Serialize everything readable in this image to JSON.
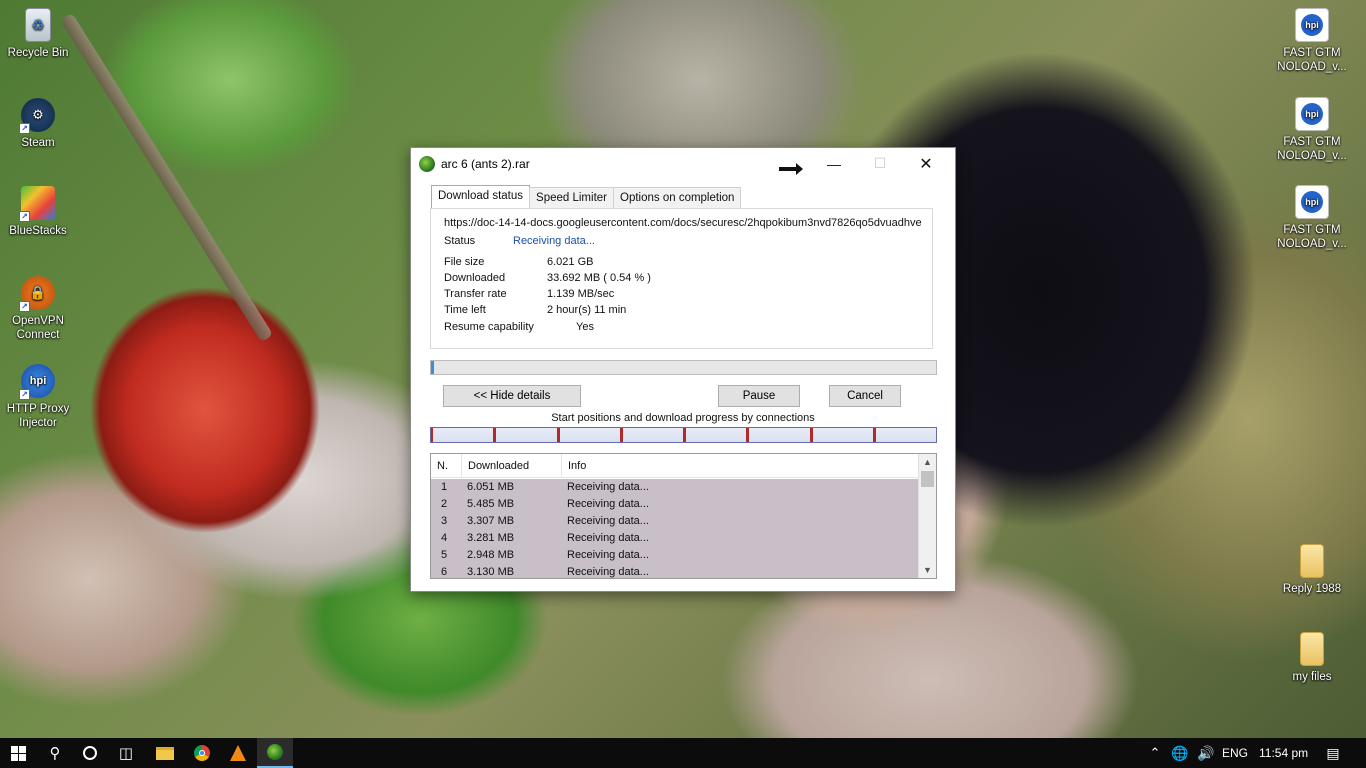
{
  "desktop": {
    "icons_left": [
      {
        "label": "Recycle Bin",
        "icon": "recycle-bin-icon"
      },
      {
        "label": "Steam",
        "icon": "steam-icon"
      },
      {
        "label": "BlueStacks",
        "icon": "bluestacks-icon"
      },
      {
        "label": "OpenVPN Connect",
        "icon": "openvpn-icon"
      },
      {
        "label": "HTTP Proxy Injector",
        "icon": "http-proxy-injector-icon"
      }
    ],
    "icons_right": [
      {
        "label": "FAST GTM NOLOAD_v...",
        "icon": "hpi-file-icon"
      },
      {
        "label": "FAST GTM NOLOAD_v...",
        "icon": "hpi-file-icon"
      },
      {
        "label": "FAST GTM NOLOAD_v...",
        "icon": "hpi-file-icon"
      },
      {
        "label": "Reply 1988",
        "icon": "folder-icon"
      },
      {
        "label": "my files",
        "icon": "folder-icon"
      }
    ]
  },
  "window": {
    "title": "arc 6 (ants 2).rar",
    "tabs": [
      "Download status",
      "Speed Limiter",
      "Options on completion"
    ],
    "url": "https://doc-14-14-docs.googleusercontent.com/docs/securesc/2hqpokibum3nvd7826qo5dvuadhve",
    "status_label": "Status",
    "status_value": "Receiving data...",
    "file_size_label": "File size",
    "file_size_value": "6.021  GB",
    "downloaded_label": "Downloaded",
    "downloaded_value": "33.692  MB  ( 0.54 % )",
    "transfer_rate_label": "Transfer rate",
    "transfer_rate_value": "1.139  MB/sec",
    "time_left_label": "Time left",
    "time_left_value": "2 hour(s) 11 min",
    "resume_label": "Resume capability",
    "resume_value": "Yes",
    "progress_fraction": 0.0054,
    "hide_details_label": "<< Hide details",
    "pause_label": "Pause",
    "cancel_label": "Cancel",
    "connections_caption": "Start positions and download progress by connections",
    "connection_segments": 8,
    "table_headers": {
      "n": "N.",
      "downloaded": "Downloaded",
      "info": "Info"
    },
    "connections": [
      {
        "n": "1",
        "downloaded": "6.051  MB",
        "info": "Receiving data..."
      },
      {
        "n": "2",
        "downloaded": "5.485  MB",
        "info": "Receiving data..."
      },
      {
        "n": "3",
        "downloaded": "3.307  MB",
        "info": "Receiving data..."
      },
      {
        "n": "4",
        "downloaded": "3.281  MB",
        "info": "Receiving data..."
      },
      {
        "n": "5",
        "downloaded": "2.948  MB",
        "info": "Receiving data..."
      },
      {
        "n": "6",
        "downloaded": "3.130  MB",
        "info": "Receiving data..."
      }
    ]
  },
  "taskbar": {
    "language": "ENG",
    "time": "11:54 pm"
  }
}
